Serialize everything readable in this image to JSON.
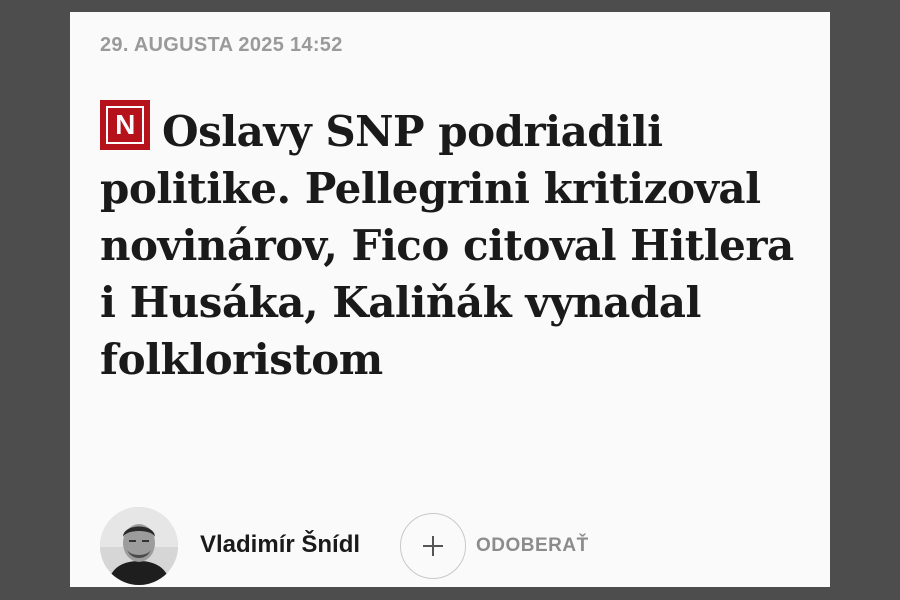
{
  "article": {
    "date": "29. AUGUSTA 2025 14:52",
    "logo_letter": "N",
    "headline": "Oslavy SNP podriadili politike. Pellegrini kritizoval novinárov, Fico citoval Hitlera i Husáka, Kaliňák vynadal folkloristom"
  },
  "author": {
    "name": "Vladimír Šnídl",
    "follow_label": "ODOBERAŤ"
  },
  "icons": {
    "logo": "denik-n-logo-icon",
    "follow": "plus-icon",
    "avatar": "author-avatar"
  },
  "colors": {
    "background": "#4d4d4d",
    "card": "#fafafa",
    "brand_red": "#b5121b",
    "date_gray": "#9a9a9a",
    "headline": "#1a1a1a"
  }
}
